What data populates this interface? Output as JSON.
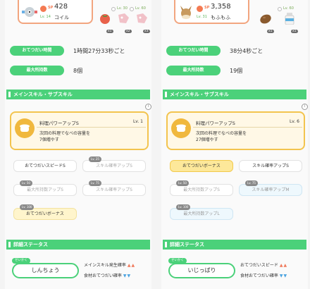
{
  "left": {
    "sp_label": "SP",
    "sp_value": "428",
    "level": "Lv. 14",
    "name": "コイル",
    "ingredients": [
      {
        "lv": "",
        "qty": "x1",
        "icon": "tomato-icon"
      },
      {
        "lv": "Lv. 30",
        "qty": "x2",
        "icon": "lock-ingredient-icon"
      },
      {
        "lv": "Lv. 60",
        "qty": "x3",
        "icon": "lock-ingredient-icon"
      }
    ],
    "stats": [
      {
        "label": "おてつだい時間",
        "value": "1時間27分33秒ごと"
      },
      {
        "label": "最大所持数",
        "value": "8個"
      }
    ],
    "section_skill": "メインスキル・サブスキル",
    "skill_name": "料理パワーアップS",
    "skill_lv": "Lv. 1",
    "skill_desc_1": "次回の料理でなべの容量を",
    "skill_desc_2": "7個増やす",
    "subskills": [
      {
        "label": "おてつだいスピードS",
        "lv": ""
      },
      {
        "label": "スキル確率アップS",
        "lv": "Lv. 25"
      },
      {
        "label": "最大所持数アップS",
        "lv": "Lv. 50"
      },
      {
        "label": "スキル確率アップS",
        "lv": "Lv. 75"
      },
      {
        "label": "おてつだいボーナス",
        "lv": "Lv. 100"
      }
    ],
    "section_status": "詳細ステータス",
    "nature_label": "せいかく",
    "nature": "しんちょう",
    "effect_up": "メインスキル発生確率",
    "effect_down": "食材おてつだい確率"
  },
  "right": {
    "sp_label": "SP",
    "sp_value": "3,358",
    "level": "Lv. 31",
    "name": "もふもふ",
    "ingredients": [
      {
        "lv": "",
        "qty": "x1",
        "icon": "coconut-icon"
      },
      {
        "lv": "Lv. 60",
        "qty": "x1",
        "icon": "milk-icon"
      }
    ],
    "stats": [
      {
        "label": "おてつだい時間",
        "value": "38分4秒ごと"
      },
      {
        "label": "最大所持数",
        "value": "19個"
      }
    ],
    "section_skill": "メインスキル・サブスキル",
    "skill_name": "料理パワーアップS",
    "skill_lv": "Lv. 6",
    "skill_desc_1": "次回の料理でなべの容量を",
    "skill_desc_2": "27個増やす",
    "subskills": [
      {
        "label": "おてつだいボーナス",
        "lv": ""
      },
      {
        "label": "スキル確率アップS",
        "lv": ""
      },
      {
        "label": "最大所持数アップS",
        "lv": "Lv. 50"
      },
      {
        "label": "スキル確率アップM",
        "lv": "Lv. 75"
      },
      {
        "label": "最大所持数アップL",
        "lv": "Lv. 100"
      }
    ],
    "section_status": "詳細ステータス",
    "nature_label": "せいかく",
    "nature": "いじっぱり",
    "effect_up": "おてつだいスピード",
    "effect_down": "食材おてつだい確率"
  },
  "info_glyph": "i",
  "arrows_up": "▲▲",
  "arrows_down": "▼▼"
}
